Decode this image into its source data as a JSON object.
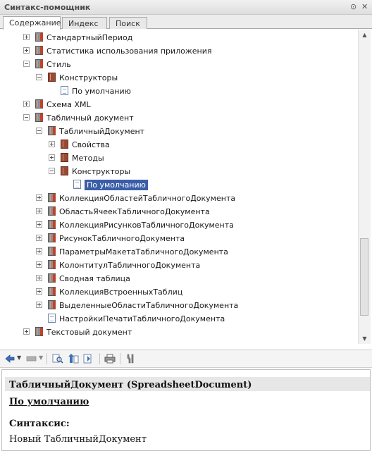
{
  "window": {
    "title": "Синтакс-помощник",
    "pin_icon": "pin-icon",
    "close_icon": "close-icon"
  },
  "tabs": [
    {
      "label": "Содержание",
      "active": true
    },
    {
      "label": "Индекс",
      "active": false
    },
    {
      "label": "Поиск",
      "active": false
    }
  ],
  "tree": [
    {
      "label": "СтандартныйПериод",
      "expander": "plus",
      "icon": "grey-book-icon"
    },
    {
      "label": "Статистика использования приложения",
      "expander": "plus",
      "icon": "grey-book-icon"
    },
    {
      "label": "Стиль",
      "expander": "minus",
      "icon": "grey-book-icon"
    },
    {
      "label": "Конструкторы",
      "expander": "minus",
      "icon": "book-icon"
    },
    {
      "label": "По умолчанию",
      "expander": "none",
      "icon": "page-icon"
    },
    {
      "label": "Схема XML",
      "expander": "plus",
      "icon": "grey-book-icon"
    },
    {
      "label": "Табличный документ",
      "expander": "minus",
      "icon": "grey-book-icon"
    },
    {
      "label": "ТабличныйДокумент",
      "expander": "minus",
      "icon": "grey-book-icon"
    },
    {
      "label": "Свойства",
      "expander": "plus",
      "icon": "book-icon"
    },
    {
      "label": "Методы",
      "expander": "plus",
      "icon": "book-icon"
    },
    {
      "label": "Конструкторы",
      "expander": "minus",
      "icon": "book-icon"
    },
    {
      "label": "По умолчанию",
      "expander": "none",
      "icon": "page-icon",
      "selected": true
    },
    {
      "label": "КоллекцияОбластейТабличногоДокумента",
      "expander": "plus",
      "icon": "grey-book-icon"
    },
    {
      "label": "ОбластьЯчеекТабличногоДокумента",
      "expander": "plus",
      "icon": "grey-book-icon"
    },
    {
      "label": "КоллекцияРисунковТабличногоДокумента",
      "expander": "plus",
      "icon": "grey-book-icon"
    },
    {
      "label": "РисунокТабличногоДокумента",
      "expander": "plus",
      "icon": "grey-book-icon"
    },
    {
      "label": "ПараметрыМакетаТабличногоДокумента",
      "expander": "plus",
      "icon": "grey-book-icon"
    },
    {
      "label": "КолонтитулТабличногоДокумента",
      "expander": "plus",
      "icon": "grey-book-icon"
    },
    {
      "label": "Сводная таблица",
      "expander": "plus",
      "icon": "grey-book-icon"
    },
    {
      "label": "КоллекцияВстроенныхТаблиц",
      "expander": "plus",
      "icon": "grey-book-icon"
    },
    {
      "label": "ВыделенныеОбластиТабличногоДокумента",
      "expander": "plus",
      "icon": "grey-book-icon"
    },
    {
      "label": "НастройкиПечатиТабличногоДокумента",
      "expander": "none",
      "icon": "page-icon"
    },
    {
      "label": "Текстовый документ",
      "expander": "plus",
      "icon": "grey-book-icon"
    }
  ],
  "toolbar": {
    "buttons": [
      "back-icon",
      "forward-icon",
      "find-in-tree-icon",
      "up-icon",
      "sync-icon",
      "print-icon",
      "settings-icon"
    ]
  },
  "content": {
    "heading": "ТабличныйДокумент (SpreadsheetDocument)",
    "subheading": "По умолчанию",
    "syntax_label": "Синтаксис:",
    "syntax": "Новый ТабличныйДокумент"
  }
}
